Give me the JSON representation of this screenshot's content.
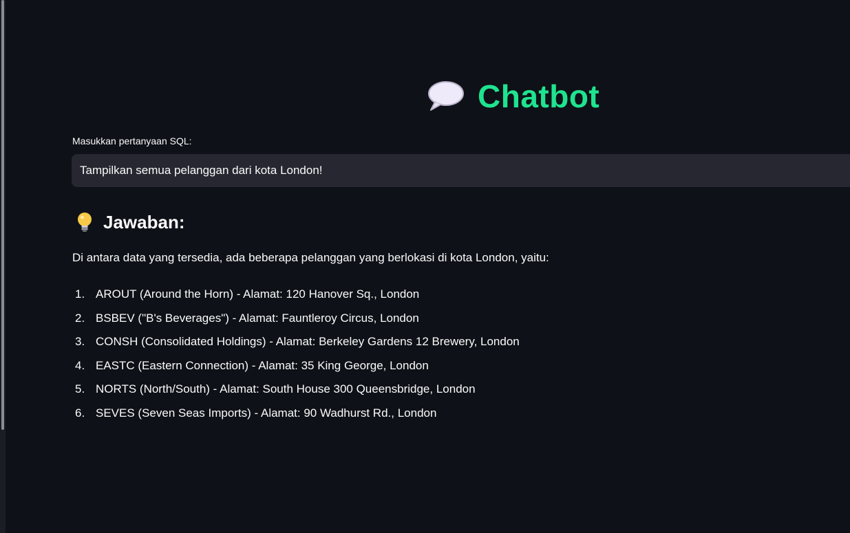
{
  "app": {
    "title": "Chatbot",
    "title_color": "#1fe38f",
    "title_icon": "speech-bubble-icon"
  },
  "query": {
    "label": "Masukkan pertanyaan SQL:",
    "value": "Tampilkan semua pelanggan dari kota London!"
  },
  "answer": {
    "icon": "light-bulb-icon",
    "heading": "Jawaban:",
    "intro": "Di antara data yang tersedia, ada beberapa pelanggan yang berlokasi di kota London, yaitu:",
    "items": [
      {
        "num": "1.",
        "text": "AROUT (Around the Horn) - Alamat: 120 Hanover Sq., London"
      },
      {
        "num": "2.",
        "text": "BSBEV (\"B's Beverages\") - Alamat: Fauntleroy Circus, London"
      },
      {
        "num": "3.",
        "text": "CONSH (Consolidated Holdings) - Alamat: Berkeley Gardens 12 Brewery, London"
      },
      {
        "num": "4.",
        "text": "EASTC (Eastern Connection) - Alamat: 35 King George, London"
      },
      {
        "num": "5.",
        "text": "NORTS (North/South) - Alamat: South House 300 Queensbridge, London"
      },
      {
        "num": "6.",
        "text": "SEVES (Seven Seas Imports) - Alamat: 90 Wadhurst Rd., London"
      }
    ]
  },
  "colors": {
    "background": "#0e1117",
    "input_background": "#262730",
    "text": "#fafafa"
  }
}
